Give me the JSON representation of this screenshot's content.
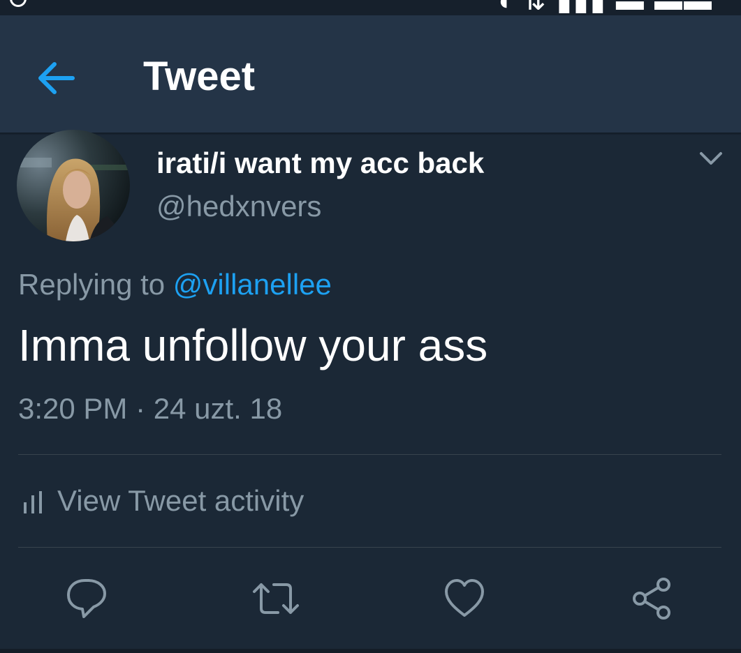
{
  "appbar": {
    "title": "Tweet",
    "back_icon": "arrow-left-icon"
  },
  "tweet": {
    "display_name": "irati/i want my acc back",
    "handle": "@hedxnvers",
    "replying_prefix": "Replying to",
    "replying_to": "@villanellee",
    "text": "Imma unfollow your ass",
    "timestamp": "3:20 PM · 24 uzt. 18"
  },
  "activity": {
    "label": "View Tweet activity",
    "icon": "bar-chart-icon"
  },
  "actions": [
    {
      "icon": "reply-icon"
    },
    {
      "icon": "retweet-icon"
    },
    {
      "icon": "like-icon"
    },
    {
      "icon": "share-icon"
    }
  ],
  "colors": {
    "background": "#1b2836",
    "appbar": "#243447",
    "accent": "#1da1f2",
    "muted": "#8899a6",
    "divider": "#38444d"
  }
}
